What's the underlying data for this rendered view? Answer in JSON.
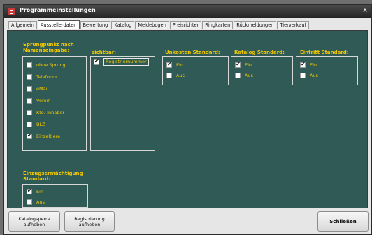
{
  "window": {
    "title": "Programmeinstellungen",
    "close_glyph": "x"
  },
  "tabs": [
    {
      "label": "Allgemein"
    },
    {
      "label": "Ausstellerdaten"
    },
    {
      "label": "Bewertung"
    },
    {
      "label": "Katalog"
    },
    {
      "label": "Meldebogen"
    },
    {
      "label": "Preisrichter"
    },
    {
      "label": "Ringkarten"
    },
    {
      "label": "Rückmeldungen"
    },
    {
      "label": "Tierverkauf"
    }
  ],
  "groups": {
    "sprungpunkt": {
      "title_line1": "Sprungpunkt nach",
      "title_line2": "Namenseingabe:",
      "options": [
        {
          "label": "ohne Sprung",
          "checked": false
        },
        {
          "label": "Telefonnr.",
          "checked": false
        },
        {
          "label": "eMail",
          "checked": false
        },
        {
          "label": "Verein",
          "checked": false
        },
        {
          "label": "Kto.-Inhaber",
          "checked": false
        },
        {
          "label": "BLZ",
          "checked": false
        },
        {
          "label": "Einzeltiere",
          "checked": true
        }
      ]
    },
    "sichtbar": {
      "title": "sichtbar:",
      "options": [
        {
          "label": "Registriernummer",
          "checked": true
        }
      ]
    },
    "unkosten": {
      "title": "Unkosten Standard:",
      "options": [
        {
          "label": "Ein",
          "checked": true
        },
        {
          "label": "Aus",
          "checked": false
        }
      ]
    },
    "katalog": {
      "title": "Katalog Standard:",
      "options": [
        {
          "label": "Ein",
          "checked": true
        },
        {
          "label": "Aus",
          "checked": false
        }
      ]
    },
    "eintritt": {
      "title": "Eintritt Standard:",
      "options": [
        {
          "label": "Ein",
          "checked": true
        },
        {
          "label": "Aus",
          "checked": false
        }
      ]
    },
    "einzug": {
      "title_line1": "Einzugsermächtigung",
      "title_line2": "Standard:",
      "options": [
        {
          "label": "Ein",
          "checked": true
        },
        {
          "label": "Aus",
          "checked": false
        }
      ]
    }
  },
  "buttons": {
    "katalogsperre_line1": "Katalogsperre",
    "katalogsperre_line2": "aufheben",
    "registrierung_line1": "Registrierung",
    "registrierung_line2": "aufheben",
    "schliessen": "Schließen"
  },
  "colors": {
    "panel_bg": "#2f5a55",
    "label_yellow": "#f0c800",
    "titlebar": "#242424"
  }
}
